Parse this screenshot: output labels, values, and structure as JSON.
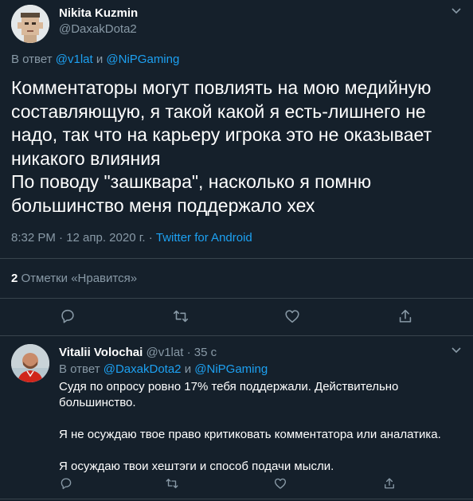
{
  "main_tweet": {
    "author_name": "Nikita Kuzmin",
    "author_handle": "@DaxakDota2",
    "reply_prefix": "В ответ",
    "reply_user_1": "@v1lat",
    "reply_joiner": "и",
    "reply_user_2": "@NiPGaming",
    "text_lines": [
      "Комментаторы могут повлиять на мою медийную",
      "составляющую, я такой какой я есть-лишнего не",
      "надо, так что на карьеру игрока это не оказывает",
      "никакого влияния",
      "По поводу \"зашквара\", насколько я помню",
      "большинство меня поддержало хех"
    ],
    "time": "8:32 PM · 12 апр. 2020 г. ·",
    "source": "Twitter for Android",
    "likes_count": "2",
    "likes_label": "Отметки «Нравится»",
    "icons": [
      "reply-icon",
      "retweet-icon",
      "like-icon",
      "share-icon",
      "chevron-down-icon"
    ]
  },
  "reply_tweet": {
    "author_name": "Vitalii Volochai",
    "author_handle": "@v1lat",
    "separator": "·",
    "time_ago": "35 с",
    "reply_prefix": "В ответ",
    "reply_user_1": "@DaxakDota2",
    "reply_joiner": "и",
    "reply_user_2": "@NiPGaming",
    "paragraph_1_line_1": "Судя по опросу ровно 17% тебя поддержали. Действительно",
    "paragraph_1_line_2": "большинство.",
    "paragraph_2": "Я не осуждаю твое право критиковать комментатора или аналатика.",
    "paragraph_3": "Я осуждаю твои хештэги и способ подачи мысли."
  },
  "colors": {
    "background": "#15202b",
    "divider": "#38444d",
    "muted": "#8899a6",
    "link": "#1da1f2",
    "text": "#ffffff"
  }
}
